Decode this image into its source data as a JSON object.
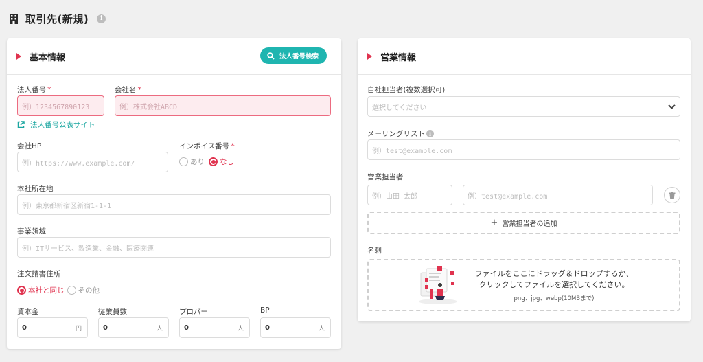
{
  "page": {
    "title": "取引先(新規)",
    "info_glyph": "i"
  },
  "basic": {
    "title": "基本情報",
    "search_button": "法人番号検索",
    "corp_number": {
      "label": "法人番号",
      "required": "*",
      "placeholder": "例）1234567890123"
    },
    "company_name": {
      "label": "会社名",
      "required": "*",
      "placeholder": "例）株式会社ABCD"
    },
    "public_site_link": "法人番号公表サイト",
    "homepage": {
      "label": "会社HP",
      "placeholder": "例）https://www.example.com/"
    },
    "invoice": {
      "label": "インボイス番号",
      "required": "*",
      "options": [
        "あり",
        "なし"
      ],
      "selected": "なし"
    },
    "hq_address": {
      "label": "本社所在地",
      "placeholder": "例）東京都新宿区新宿1-1-1"
    },
    "business_domain": {
      "label": "事業領域",
      "placeholder": "例）ITサービス、製造業、金融、医療関連"
    },
    "order_address": {
      "label": "注文請書住所",
      "options": [
        "本社と同じ",
        "その他"
      ],
      "selected": "本社と同じ"
    },
    "capital": {
      "label": "資本金",
      "value": "0",
      "unit": "円"
    },
    "employees": {
      "label": "従業員数",
      "value": "0",
      "unit": "人"
    },
    "proper": {
      "label": "プロパー",
      "value": "0",
      "unit": "人"
    },
    "bp": {
      "label": "BP",
      "value": "0",
      "unit": "人"
    }
  },
  "sales": {
    "title": "営業情報",
    "own_rep": {
      "label": "自社担当者(複数選択可)",
      "placeholder": "選択してください"
    },
    "mailing_list": {
      "label": "メーリングリスト",
      "placeholder": "例）test@example.com"
    },
    "sales_rep": {
      "label": "営業担当者",
      "name_placeholder": "例）山田 太郎",
      "email_placeholder": "例）test@example.com"
    },
    "add_rep_button": "営業担当者の追加",
    "business_card": {
      "label": "名刺",
      "drop_line1": "ファイルをここにドラッグ＆ドロップするか、",
      "drop_line2": "クリックしてファイルを選択してください。",
      "formats": "png、jpg、webp(10MBまで)"
    }
  },
  "colors": {
    "accent": "#e0334f",
    "teal": "#1fb5b0",
    "background": "#f0f0f0"
  }
}
